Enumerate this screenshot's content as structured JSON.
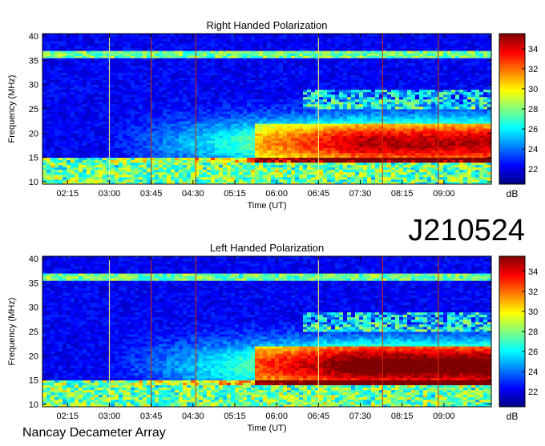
{
  "observation_id": "J210524",
  "footer": "Nancay Decameter Array",
  "colors": {
    "colormap": [
      "#00007f",
      "#0000ff",
      "#007fff",
      "#00ffff",
      "#7fff7f",
      "#ffff00",
      "#ff7f00",
      "#ff0000",
      "#7f0000"
    ]
  },
  "chart_data": [
    {
      "type": "heatmap",
      "title": "Right Handed Polarization",
      "xlabel": "Time (UT)",
      "ylabel": "Frequency (MHz)",
      "x_ticks": [
        "02:15",
        "03:00",
        "03:45",
        "04:30",
        "05:15",
        "06:00",
        "06:45",
        "07:30",
        "08:15",
        "09:00"
      ],
      "x_tick_hours": [
        2.25,
        3.0,
        3.75,
        4.5,
        5.25,
        6.0,
        6.75,
        7.5,
        8.25,
        9.0
      ],
      "xlim_hours": [
        1.8,
        9.85
      ],
      "ylim": [
        9.5,
        40.5
      ],
      "y_ticks": [
        10,
        15,
        20,
        25,
        30,
        35,
        40
      ],
      "colorbar": {
        "label": "dB",
        "ticks": [
          22,
          24,
          26,
          28,
          30,
          32,
          34
        ],
        "range": [
          20.5,
          35.5
        ]
      },
      "grid": false
    },
    {
      "type": "heatmap",
      "title": "Left Handed Polarization",
      "xlabel": "Time (UT)",
      "ylabel": "Frequency (MHz)",
      "x_ticks": [
        "02:15",
        "03:00",
        "03:45",
        "04:30",
        "05:15",
        "06:00",
        "06:45",
        "07:30",
        "08:15",
        "09:00"
      ],
      "x_tick_hours": [
        2.25,
        3.0,
        3.75,
        4.5,
        5.25,
        6.0,
        6.75,
        7.5,
        8.25,
        9.0
      ],
      "xlim_hours": [
        1.8,
        9.85
      ],
      "ylim": [
        9.5,
        40.5
      ],
      "y_ticks": [
        10,
        15,
        20,
        25,
        30,
        35,
        40
      ],
      "colorbar": {
        "label": "dB",
        "ticks": [
          22,
          24,
          26,
          28,
          30,
          32,
          34
        ],
        "range": [
          20.5,
          35.5
        ]
      },
      "grid": false
    }
  ]
}
